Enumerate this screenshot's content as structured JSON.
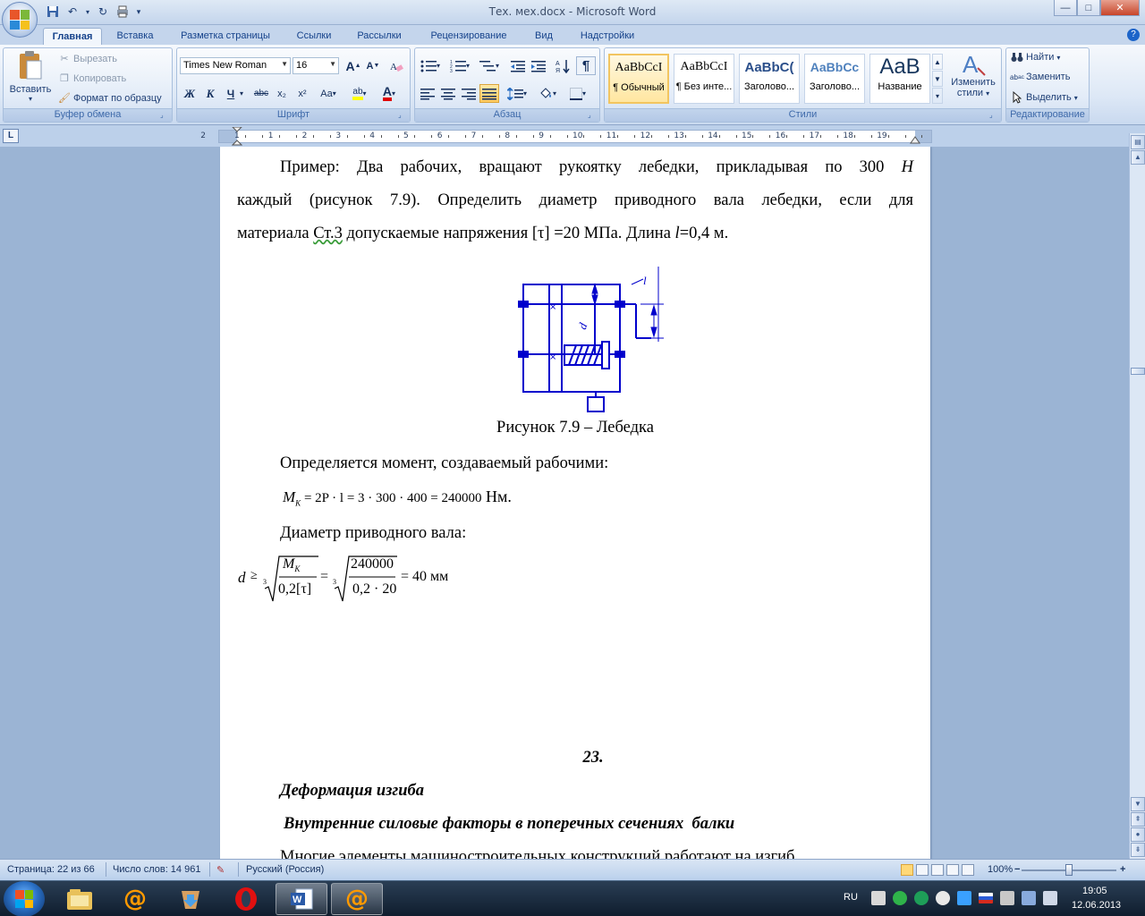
{
  "window": {
    "title": "Тех. мех.docx - Microsoft Word",
    "controls": {
      "minimize": "—",
      "maximize": "□",
      "close": "✕"
    }
  },
  "tabs": [
    "Главная",
    "Вставка",
    "Разметка страницы",
    "Ссылки",
    "Рассылки",
    "Рецензирование",
    "Вид",
    "Надстройки"
  ],
  "ribbon": {
    "clipboard": {
      "label": "Буфер обмена",
      "paste": "Вставить",
      "cut": "Вырезать",
      "copy": "Копировать",
      "format_painter": "Формат по образцу"
    },
    "font": {
      "label": "Шрифт",
      "font_name": "Times New Roman",
      "font_size": "16",
      "grow": "A",
      "shrink": "A",
      "bold": "Ж",
      "italic": "К",
      "underline": "Ч",
      "strikethrough": "abc",
      "subscript": "x₂",
      "superscript": "x²",
      "change_case": "Aa",
      "highlight": "ab",
      "font_color": "A"
    },
    "paragraph": {
      "label": "Абзац",
      "pilcrow": "¶"
    },
    "styles": {
      "label": "Стили",
      "items": [
        {
          "sample": "AaBbCcI",
          "name": "¶ Обычный"
        },
        {
          "sample": "AaBbCcI",
          "name": "¶ Без инте..."
        },
        {
          "sample": "AaBbC(",
          "name": "Заголово..."
        },
        {
          "sample": "AaBbCc",
          "name": "Заголово..."
        },
        {
          "sample": "AaB",
          "name": "Название"
        }
      ],
      "change_styles_1": "Изменить",
      "change_styles_2": "стили"
    },
    "editing": {
      "label": "Редактирование",
      "find": "Найти",
      "replace": "Заменить",
      "select": "Выделить"
    }
  },
  "ruler": {
    "corner": "L",
    "numbers": [
      "2",
      "1",
      "1",
      "2",
      "3",
      "4",
      "5",
      "6",
      "7",
      "8",
      "9",
      "10",
      "11",
      "12",
      "13",
      "14",
      "15",
      "16",
      "17",
      "18",
      "19"
    ]
  },
  "document": {
    "p1_line1": "Пример: Два рабочих, вращают рукоятку лебедки, прикладывая по 300",
    "p1_unit": "Н",
    "p1_line2": "каждый (рисунок 7.9). Определить диаметр приводного вала лебедки, если для",
    "p1_line3_a": "материала",
    "p1_line3_b": "Ст.3",
    "p1_line3_c": "допускаемые напряжения [τ] =20 МПа. Длина",
    "p1_line3_l": "l",
    "p1_line3_d": "=0,4 м.",
    "figure_l_label": "l",
    "figure_d_label": "d",
    "caption": "Рисунок 7.9 – Лебедка",
    "p2": "Определяется момент, создаваемый рабочими:",
    "f1_lhs": "M",
    "f1_sub": "K",
    "f1_rest": " = 2P · l = 3 · 300 · 400 = 240000",
    "f1_unit": " Нм.",
    "p3": "Диаметр приводного вала:",
    "f2_d": "d",
    "f2_geq": "≥",
    "f2_root": "3",
    "f2_num1": "M",
    "f2_num1_sub": "K",
    "f2_den1": "0,2[τ]",
    "f2_eq": "=",
    "f2_num2": "240000",
    "f2_den2": "0,2 · 20",
    "f2_result": "= 40 мм",
    "section_num": "23.",
    "heading1": "Деформация изгиба",
    "heading2": "Внутренние силовые факторы в поперечных сечениях  балки",
    "p4": "Многие элементы машиностроительных конструкций работают на изгиб"
  },
  "statusbar": {
    "page": "Страница: 22 из 66",
    "words": "Число слов: 14 961",
    "language": "Русский (Россия)",
    "zoom": "100%",
    "zoom_minus": "−",
    "zoom_plus": "+",
    "zoom_level": 0.5
  },
  "taskbar": {
    "lang": "RU",
    "time": "19:05",
    "date": "12.06.2013"
  },
  "colors": {
    "ribbon_text": "#15428b",
    "drawing_blue": "#0000cc",
    "accent_orange": "#f2c560"
  }
}
